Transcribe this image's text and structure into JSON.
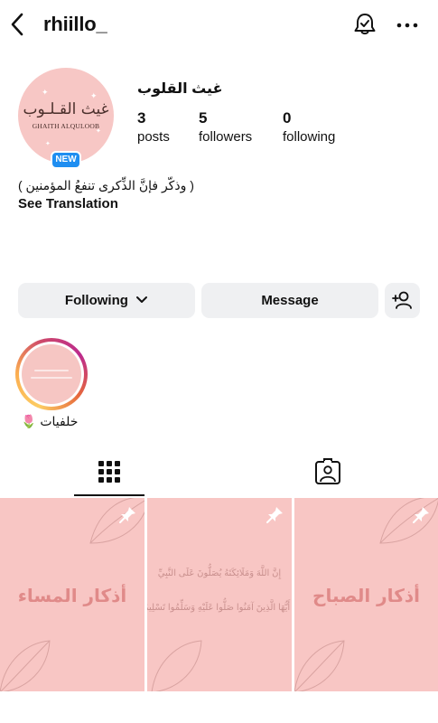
{
  "header": {
    "username": "rhiillo_"
  },
  "profile": {
    "display_name": "غيث القلوب",
    "avatar_text_ar": "غيث القـلـوب",
    "avatar_text_en": "GHAITH ALQULOOB",
    "new_badge": "NEW",
    "stats": [
      {
        "value": "3",
        "label": "posts"
      },
      {
        "value": "5",
        "label": "followers"
      },
      {
        "value": "0",
        "label": "following"
      }
    ],
    "bio": "( وذكّر فإنَّ الذِّكرى تنفعُ المؤمنين )",
    "see_translation": "See Translation"
  },
  "actions": {
    "following_label": "Following",
    "message_label": "Message"
  },
  "highlights": [
    {
      "label": "خلفيات 🌷"
    }
  ],
  "posts": [
    {
      "title": "أذكار المساء"
    },
    {
      "title": "",
      "verse_line_1": "إِنَّ اللَّهَ وَمَلَائِكَتَهُ يُصَلُّونَ عَلَى النَّبِيِّ",
      "verse_line_2": "يَا أَيُّهَا الَّذِينَ آمَنُوا صَلُّوا عَلَيْهِ وَسَلِّمُوا تَسْلِيمًا"
    },
    {
      "title": "أذكار الصباح"
    }
  ],
  "colors": {
    "post_bg": "#f8c6c4",
    "button_bg": "#eff0f2",
    "badge_blue": "#1f8ef1",
    "post_title": "#e08a89"
  },
  "icons": {
    "back": "chevron-left-icon",
    "notifications": "bell-icon",
    "more": "more-horizontal-icon",
    "add_user": "add-user-icon",
    "grid": "grid-icon",
    "tagged": "tagged-icon",
    "pinned": "pin-icon"
  }
}
